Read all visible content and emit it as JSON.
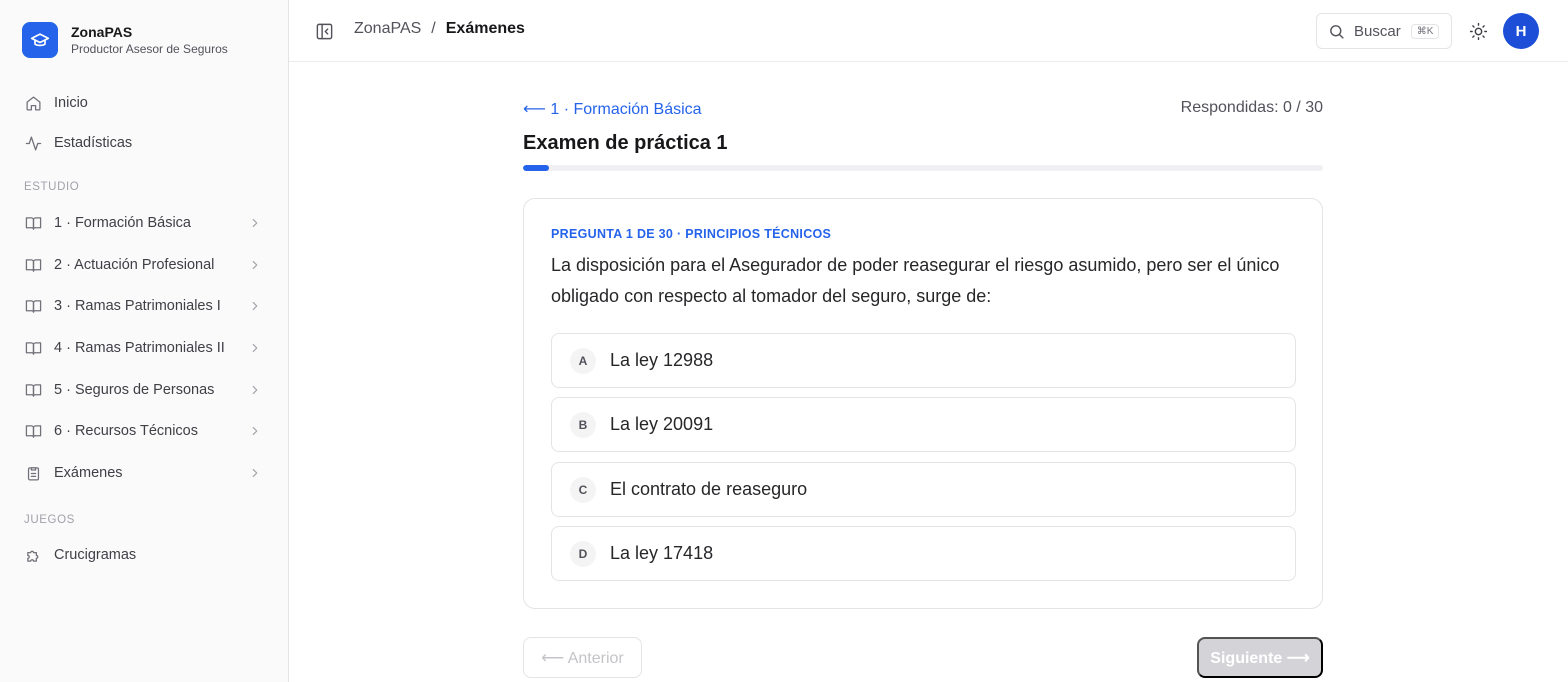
{
  "brand": {
    "name": "ZonaPAS",
    "subtitle": "Productor Asesor de Seguros",
    "logo_icon": "graduation-cap-icon",
    "accent": "#2563eb"
  },
  "sidebar": {
    "top_items": [
      {
        "label": "Inicio",
        "icon": "home-icon"
      },
      {
        "label": "Estadísticas",
        "icon": "activity-icon"
      }
    ],
    "study_section": "ESTUDIO",
    "study_items": [
      {
        "label": "1 · Formación Básica",
        "icon": "book-icon"
      },
      {
        "label": "2 · Actuación Profesional",
        "icon": "book-icon"
      },
      {
        "label": "3 · Ramas Patrimoniales I",
        "icon": "book-icon"
      },
      {
        "label": "4 · Ramas Patrimoniales II",
        "icon": "book-icon"
      },
      {
        "label": "5 · Seguros de Personas",
        "icon": "book-icon"
      },
      {
        "label": "6 · Recursos Técnicos",
        "icon": "book-icon"
      },
      {
        "label": "Exámenes",
        "icon": "clipboard-icon"
      }
    ],
    "games_section": "JUEGOS",
    "games_items": [
      {
        "label": "Crucigramas",
        "icon": "puzzle-icon"
      }
    ]
  },
  "header": {
    "breadcrumb_root": "ZonaPAS",
    "breadcrumb_sep": "/",
    "breadcrumb_current": "Exámenes",
    "search_label": "Buscar",
    "search_shortcut": "⌘K",
    "avatar_initial": "H"
  },
  "exam": {
    "back_label": "⟵ 1 · Formación Básica",
    "answered": "Respondidas: 0 / 30",
    "title": "Examen de práctica 1",
    "progress_fraction": 0.033,
    "question_label": "PREGUNTA 1 DE 30 · PRINCIPIOS TÉCNICOS",
    "question_text": "La disposición para el Asegurador de poder reasegurar el riesgo asumido, pero ser el único obligado con respecto al tomador del seguro, surge de:",
    "options": [
      {
        "letter": "A",
        "text": "La ley 12988"
      },
      {
        "letter": "B",
        "text": "La ley 20091"
      },
      {
        "letter": "C",
        "text": "El contrato de reaseguro"
      },
      {
        "letter": "D",
        "text": "La ley 17418"
      }
    ],
    "prev_label": "⟵ Anterior",
    "next_label": "Siguiente ⟶"
  }
}
